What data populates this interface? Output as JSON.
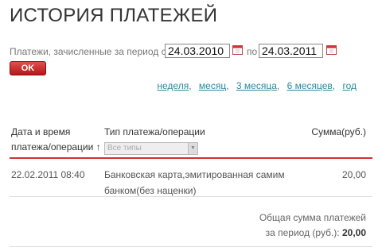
{
  "page": {
    "title": "ИСТОРИЯ ПЛАТЕЖЕЙ"
  },
  "filter": {
    "period_label": "Платежи, зачисленные за период с",
    "date_from": "24.03.2010",
    "to_label": "по",
    "date_to": "24.03.2011",
    "ok_label": "OK",
    "ranges": [
      {
        "label": "неделя"
      },
      {
        "label": "месяц"
      },
      {
        "label": "3 месяца"
      },
      {
        "label": "6 месяцев"
      },
      {
        "label": "год"
      }
    ],
    "separator": ","
  },
  "table": {
    "col_date_line1": "Дата и время",
    "col_date_line2": "платежа/операции ↑",
    "col_type": "Тип платежа/операции",
    "col_type_filter": "Все типы",
    "col_amount": "Сумма(руб.)",
    "rows": [
      {
        "date": "22.02.2011 08:40",
        "type_line1": "Банковская карта,эмитированная самим",
        "type_line2": "банком(без наценки)",
        "amount": "20,00"
      }
    ]
  },
  "summary": {
    "label_line1": "Общая сумма платежей",
    "label_line2": "за период (руб.):",
    "total": "20,00"
  },
  "colors": {
    "accent_red": "#c33333",
    "link": "#2a8a9a"
  }
}
